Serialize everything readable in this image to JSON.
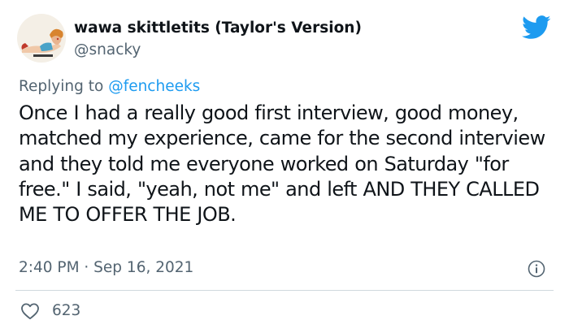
{
  "author": {
    "display_name": "wawa skittletits (Taylor's Version)",
    "handle": "@snacky",
    "avatar_icon": "pinup-illustration-avatar"
  },
  "reply": {
    "prefix": "Replying to ",
    "mention": "@fencheeks"
  },
  "tweet": {
    "text": "Once I had a really good first interview, good money, matched my experience, came for the second interview and they told me everyone worked on Saturday \"for free.\" I said, \"yeah, not me\" and left AND THEY CALLED ME TO OFFER THE JOB.",
    "timestamp": "2:40 PM · Sep 16, 2021"
  },
  "engagement": {
    "likes": "623"
  },
  "colors": {
    "twitter_blue": "#1d9bf0",
    "secondary_text": "#536471",
    "primary_text": "#0f1419",
    "divider": "#cfd9de"
  },
  "icons": {
    "brand": "twitter-bird-icon",
    "info": "info-icon",
    "like": "heart-icon"
  }
}
